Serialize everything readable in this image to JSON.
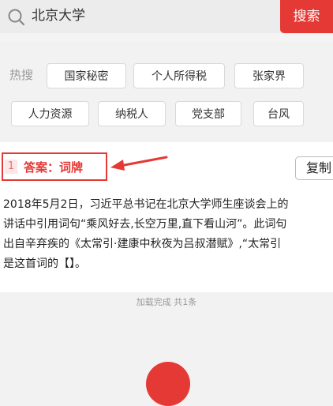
{
  "search": {
    "query": "北京大学",
    "button_label": "搜索"
  },
  "hot": {
    "label": "热搜",
    "tags": [
      "国家秘密",
      "个人所得税",
      "张家界",
      "人力资源",
      "纳税人",
      "党支部",
      "台风"
    ]
  },
  "result": {
    "index": "1",
    "answer": "答案：词牌",
    "copy_label": "复制",
    "lines": [
      "2018年5月2日，习近平总书记在北京大学师生座谈会上的",
      "讲话中引用词句“乘风好去,长空万里,直下看山河”。此词句",
      "出自辛弃疾的《太常引·建康中秋夜为吕叔潜赋》,“太常引",
      "是这首词的【】。"
    ]
  },
  "status": "加载完成 共1条",
  "colors": {
    "accent": "#e53935",
    "tag_border": "#d9d9d9",
    "muted_text": "#999999"
  }
}
